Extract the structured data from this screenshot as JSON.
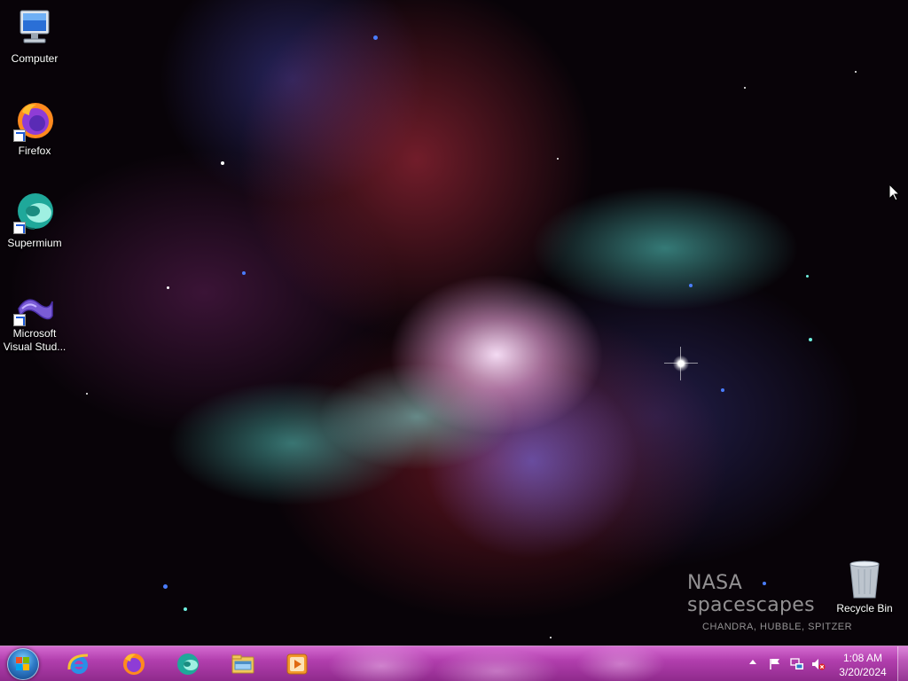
{
  "desktop": {
    "icons": [
      {
        "label": "Computer",
        "icon": "computer-icon"
      },
      {
        "label": "Firefox",
        "icon": "firefox-icon"
      },
      {
        "label": "Supermium",
        "icon": "supermium-icon"
      },
      {
        "label": "Microsoft Visual Stud...",
        "icon": "visual-studio-icon"
      },
      {
        "label": "Recycle Bin",
        "icon": "recycle-bin-icon"
      }
    ],
    "wallpaper": {
      "title": "NASA spacescapes",
      "subtitle": "CHANDRA, HUBBLE, SPITZER"
    }
  },
  "taskbar": {
    "start_icon": "windows-start-orb",
    "pinned": [
      {
        "icon": "internet-explorer-icon"
      },
      {
        "icon": "firefox-icon"
      },
      {
        "icon": "supermium-icon"
      },
      {
        "icon": "file-explorer-icon"
      },
      {
        "icon": "media-player-icon"
      }
    ],
    "tray": {
      "icons": [
        "show-hidden-icons",
        "action-center-flag-icon",
        "network-icon",
        "volume-muted-icon"
      ],
      "time": "1:08 AM",
      "date": "3/20/2024"
    }
  },
  "colors": {
    "taskbar": "#b23fae",
    "desktop_background": "#080308"
  }
}
